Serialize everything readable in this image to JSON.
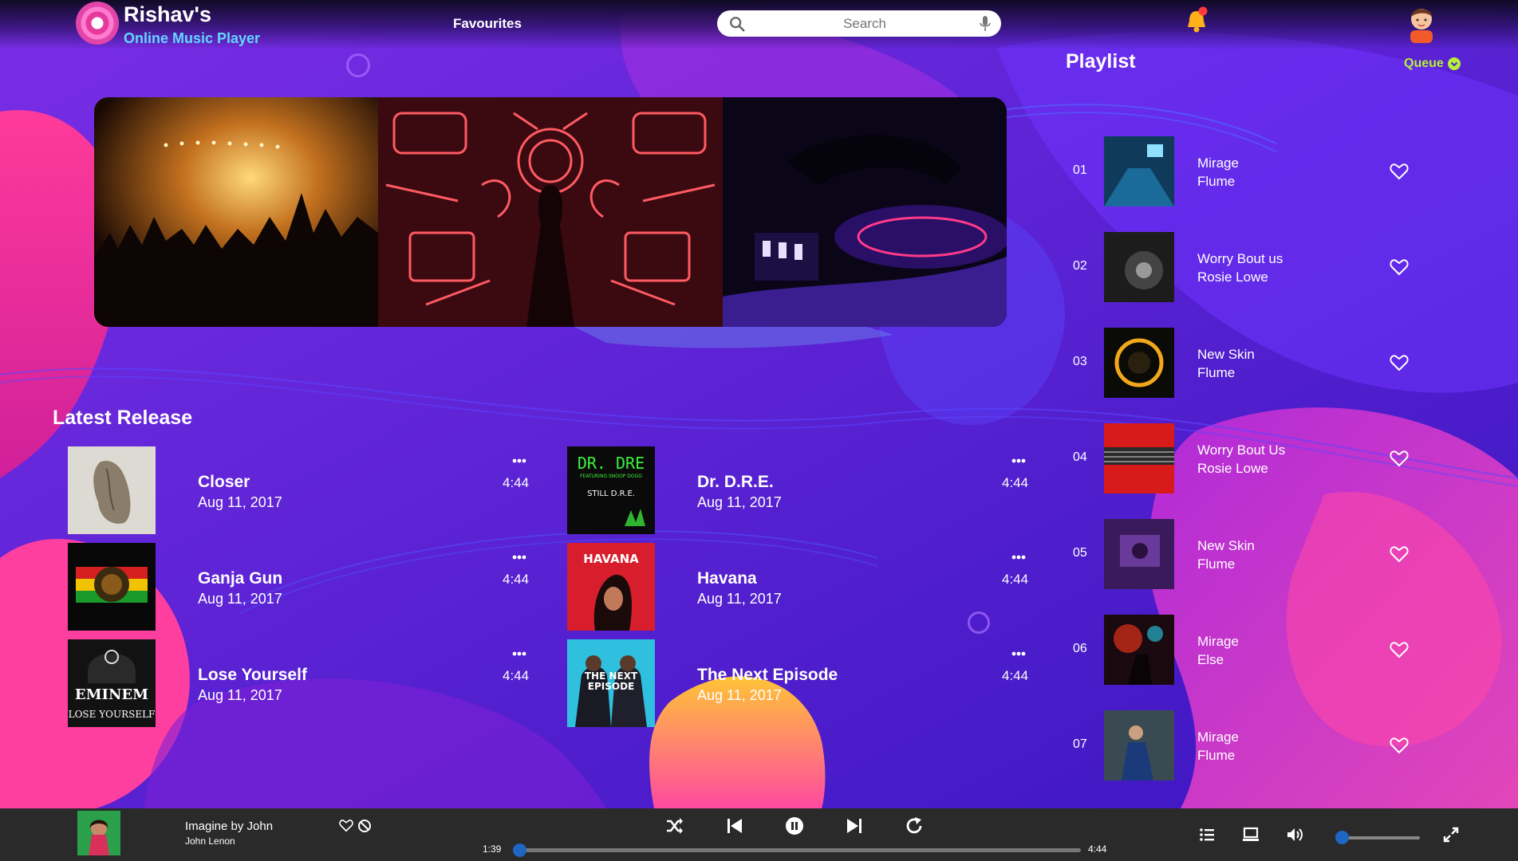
{
  "colors": {
    "background": "#4a1ed0",
    "accent_pink": "#ff3fa0",
    "accent_cyan": "#61d7ff",
    "queue_green": "#b6f03a",
    "player_bar": "#2a2a2a",
    "progress_blue": "#1f66c2"
  },
  "header": {
    "brand_title": "Rishav's",
    "brand_subtitle": "Online Music Player",
    "nav_favourites": "Favourites",
    "search_placeholder": "Search",
    "icons": [
      "logo-disc-icon",
      "search-icon",
      "mic-icon",
      "bell-icon",
      "avatar-icon"
    ]
  },
  "playlist": {
    "title": "Playlist",
    "queue_label": "Queue",
    "items": [
      {
        "num": "01",
        "title": "Mirage",
        "artist": "Flume"
      },
      {
        "num": "02",
        "title": "Worry Bout us",
        "artist": "Rosie Lowe"
      },
      {
        "num": "03",
        "title": "New Skin",
        "artist": "Flume"
      },
      {
        "num": "04",
        "title": "Worry Bout Us",
        "artist": "Rosie Lowe"
      },
      {
        "num": "05",
        "title": "New Skin",
        "artist": "Flume"
      },
      {
        "num": "06",
        "title": "Mirage",
        "artist": "Else"
      },
      {
        "num": "07",
        "title": "Mirage",
        "artist": "Flume"
      }
    ]
  },
  "latest": {
    "title": "Latest Release",
    "items": [
      {
        "title": "Closer",
        "date": "Aug 11, 2017",
        "duration": "4:44"
      },
      {
        "title": "Dr. D.R.E.",
        "date": "Aug 11, 2017",
        "duration": "4:44"
      },
      {
        "title": "Ganja Gun",
        "date": "Aug 11, 2017",
        "duration": "4:44"
      },
      {
        "title": "Havana",
        "date": "Aug 11, 2017",
        "duration": "4:44"
      },
      {
        "title": "Lose Yourself",
        "date": "Aug 11, 2017",
        "duration": "4:44"
      },
      {
        "title": "The Next Episode",
        "date": "Aug 11, 2017",
        "duration": "4:44"
      }
    ],
    "cover_text": {
      "dre_line1": "DR. DRE",
      "dre_line2": "FEATURING SNOOP DOGG",
      "dre_line3": "STILL D.R.E.",
      "havana": "HAVANA",
      "eminem": "EMINEM",
      "lose_yourself": "LOSE YOURSELF",
      "next_episode_1": "THE NEXT",
      "next_episode_2": "EPISODE"
    }
  },
  "player": {
    "now_playing_title": "Imagine by John",
    "now_playing_artist": "John Lenon",
    "current_time": "1:39",
    "total_time": "4:44",
    "progress": 0.0,
    "volume": 0.0,
    "controls": [
      "shuffle-icon",
      "previous-icon",
      "pause-icon",
      "next-icon",
      "repeat-icon"
    ],
    "right_icons": [
      "queue-list-icon",
      "device-icon",
      "volume-icon",
      "fullscreen-icon"
    ]
  }
}
